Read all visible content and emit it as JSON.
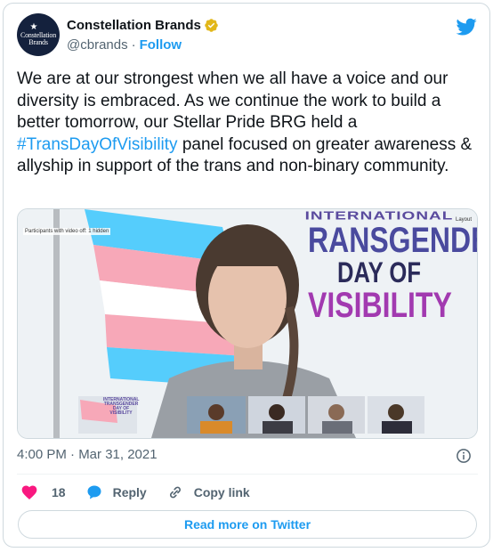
{
  "colors": {
    "accent": "#1d9bf0",
    "text_primary": "#0f1419",
    "text_secondary": "#536471",
    "like": "#f91880",
    "verified": "#e2b719",
    "border": "#cfd9de"
  },
  "author": {
    "avatar_text": "Constellation Brands",
    "display_name": "Constellation Brands",
    "handle": "@cbrands",
    "separator": "·",
    "follow_label": "Follow",
    "verified_icon": "verified-badge-icon"
  },
  "platform_icon": "twitter-bird-icon",
  "tweet": {
    "text_before": "We are at our strongest when we all have a voice and our diversity is embraced. As we continue the work to build a better tomorrow, our Stellar Pride BRG held a ",
    "hashtag": "#TransDayOfVisibility",
    "text_after": " panel focused on greater awareness & allyship in support of the trans and non-binary community."
  },
  "media": {
    "participants_note": "Participants with video off: 1 hidden",
    "layout_label": "Layout",
    "banner": {
      "line1": "INTERNATIONAL",
      "line2": "RANSGENDER",
      "line3": "DAY OF",
      "line4": "VISIBILITY"
    },
    "thumbnail_label": [
      "INTERNATIONAL",
      "TRANSGENDER",
      "DAY OF",
      "VISIBILITY"
    ]
  },
  "timestamp": "4:00 PM · Mar 31, 2021",
  "info_icon": "info-icon",
  "actions": {
    "like_count": "18",
    "reply_label": "Reply",
    "copy_link_label": "Copy link"
  },
  "read_more_label": "Read more on Twitter"
}
